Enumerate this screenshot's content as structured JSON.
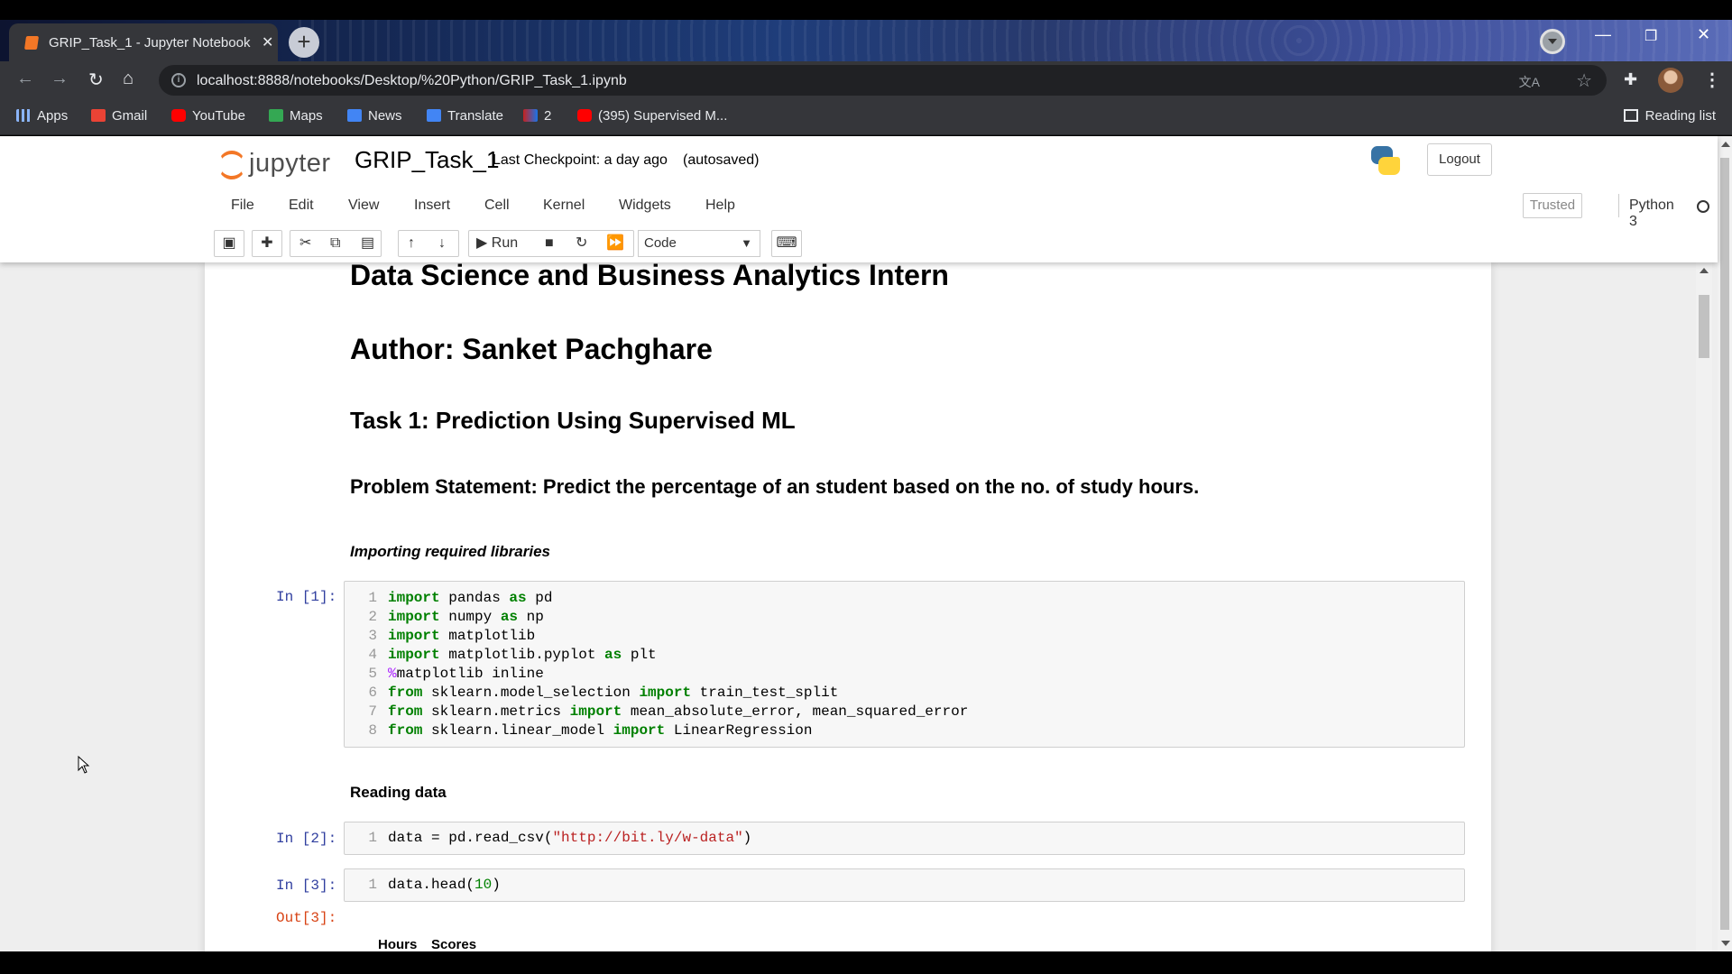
{
  "browser": {
    "tab_title": "GRIP_Task_1 - Jupyter Notebook",
    "url": "localhost:8888/notebooks/Desktop/%20Python/GRIP_Task_1.ipynb",
    "bookmarks": [
      {
        "label": "Apps",
        "color": "#8ab4f8"
      },
      {
        "label": "Gmail",
        "color": "#ea4335"
      },
      {
        "label": "YouTube",
        "color": "#ff0000"
      },
      {
        "label": "Maps",
        "color": "#34a853"
      },
      {
        "label": "News",
        "color": "#4285f4"
      },
      {
        "label": "Translate",
        "color": "#4285f4"
      },
      {
        "label": "2",
        "color": "#c5221f"
      },
      {
        "label": "(395) Supervised M...",
        "color": "#ff0000"
      }
    ],
    "reading_list": "Reading list"
  },
  "jupyter": {
    "logo_text": "jupyter",
    "notebook_name": "GRIP_Task_1",
    "checkpoint": "Last Checkpoint: a day ago",
    "autosaved": "(autosaved)",
    "logout_label": "Logout",
    "menu": [
      "File",
      "Edit",
      "View",
      "Insert",
      "Cell",
      "Kernel",
      "Widgets",
      "Help"
    ],
    "trusted_label": "Trusted",
    "kernel_name": "Python 3",
    "run_label": "Run",
    "cell_type": "Code"
  },
  "notebook": {
    "heading1": "Data Science and Business Analytics Intern",
    "heading2": "Author: Sanket Pachghare",
    "heading3": "Task 1: Prediction Using Supervised ML",
    "heading4": "Problem Statement: Predict the percentage of an student based on the no. of study hours.",
    "section_import": "Importing required libraries",
    "prompt1": "In [1]:",
    "section_read": "Reading data",
    "prompt2": "In [2]:",
    "prompt3": "In [3]:",
    "out3": "Out[3]:",
    "df_columns": [
      "Hours",
      "Scores"
    ],
    "cell1_lines": [
      {
        "n": "1",
        "code": "import pandas as pd"
      },
      {
        "n": "2",
        "code": "import numpy as np"
      },
      {
        "n": "3",
        "code": "import matplotlib"
      },
      {
        "n": "4",
        "code": "import matplotlib.pyplot as plt"
      },
      {
        "n": "5",
        "code": "%matplotlib inline"
      },
      {
        "n": "6",
        "code": "from sklearn.model_selection import train_test_split"
      },
      {
        "n": "7",
        "code": "from sklearn.metrics import mean_absolute_error, mean_squared_error"
      },
      {
        "n": "8",
        "code": "from sklearn.linear_model import LinearRegression"
      }
    ],
    "cell2_lines": [
      {
        "n": "1",
        "code": "data = pd.read_csv(\"http://bit.ly/w-data\")"
      }
    ],
    "cell3_lines": [
      {
        "n": "1",
        "code": "data.head(10)"
      }
    ]
  }
}
